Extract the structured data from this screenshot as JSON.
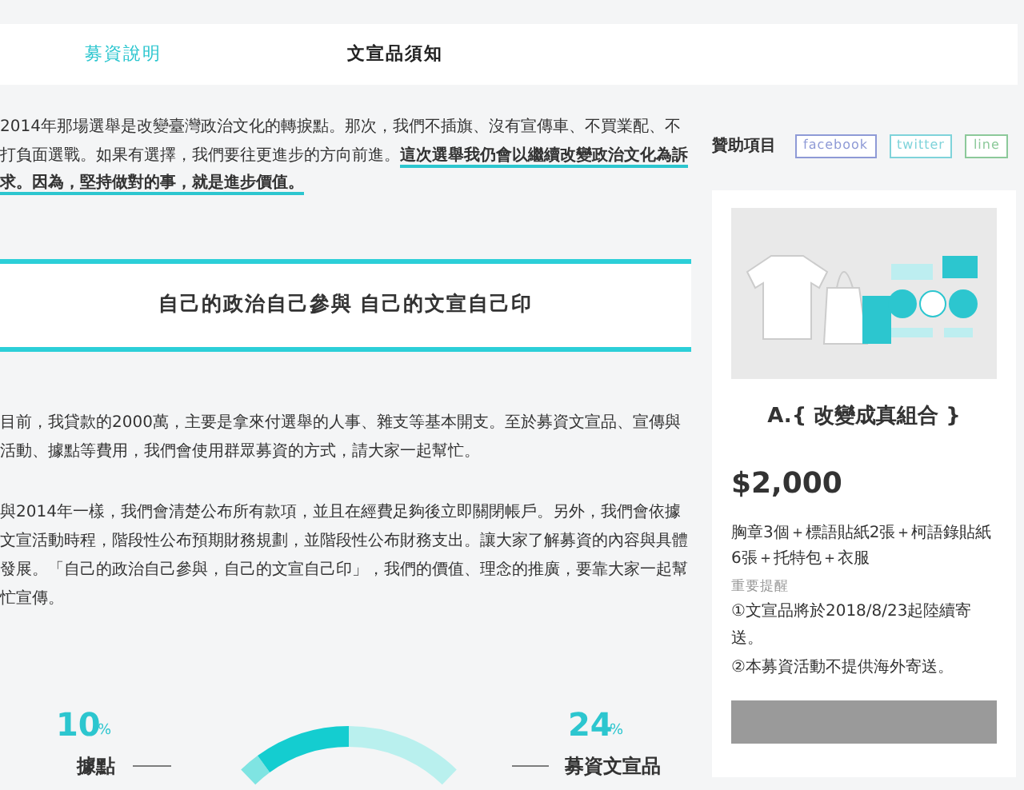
{
  "tabs": [
    {
      "label": "募資說明",
      "selected": true
    },
    {
      "label": "文宣品須知",
      "selected": false
    }
  ],
  "intro": {
    "text": "2014年那場選舉是改變臺灣政治文化的轉捩點。那次，我們不插旗、沒有宣傳車、不買業配、不打負面選戰。如果有選擇，我們要往更進步的方向前進。",
    "highlight": "這次選舉我仍會以繼續改變政治文化為訴求。因為，堅持做對的事，就是進步價值。"
  },
  "banner": {
    "title": "自己的政治自己參與 自己的文宣自己印"
  },
  "paragraphs": [
    "目前，我貸款的2000萬，主要是拿來付選舉的人事、雜支等基本開支。至於募資文宣品、宣傳與活動、據點等費用，我們會使用群眾募資的方式，請大家一起幫忙。",
    "與2014年一樣，我們會清楚公布所有款項，並且在經費足夠後立即關閉帳戶。另外，我們會依據文宣活動時程，階段性公布預期財務規劃，並階段性公布財務支出。讓大家了解募資的內容與具體發展。「自己的政治自己參與，自己的文宣自己印」，我們的價值、理念的推廣，要靠大家一起幫忙宣傳。"
  ],
  "chart": {
    "callouts": [
      {
        "value": "10",
        "unit": "%",
        "name": "據點"
      },
      {
        "value": "24",
        "unit": "%",
        "name": "募資文宣品"
      }
    ]
  },
  "sidebar": {
    "heading": "贊助項目",
    "share": [
      {
        "label": "facebook",
        "color": "#8e9ad6"
      },
      {
        "label": "twitter",
        "color": "#7fd3da"
      },
      {
        "label": "line",
        "color": "#8cc99a"
      }
    ],
    "rewards": [
      {
        "image": {
          "kind": "picture"
        },
        "title": "A.{ 改變成真組合 }",
        "price": "$2,000",
        "description": "胸章3個＋標語貼紙2張＋柯語錄貼紙6張＋托特包＋衣服",
        "notice_label": "重要提醒",
        "notices": [
          "①文宣品將於2018/8/23起陸續寄送。",
          "②本募資活動不提供海外寄送。"
        ]
      }
    ]
  }
}
